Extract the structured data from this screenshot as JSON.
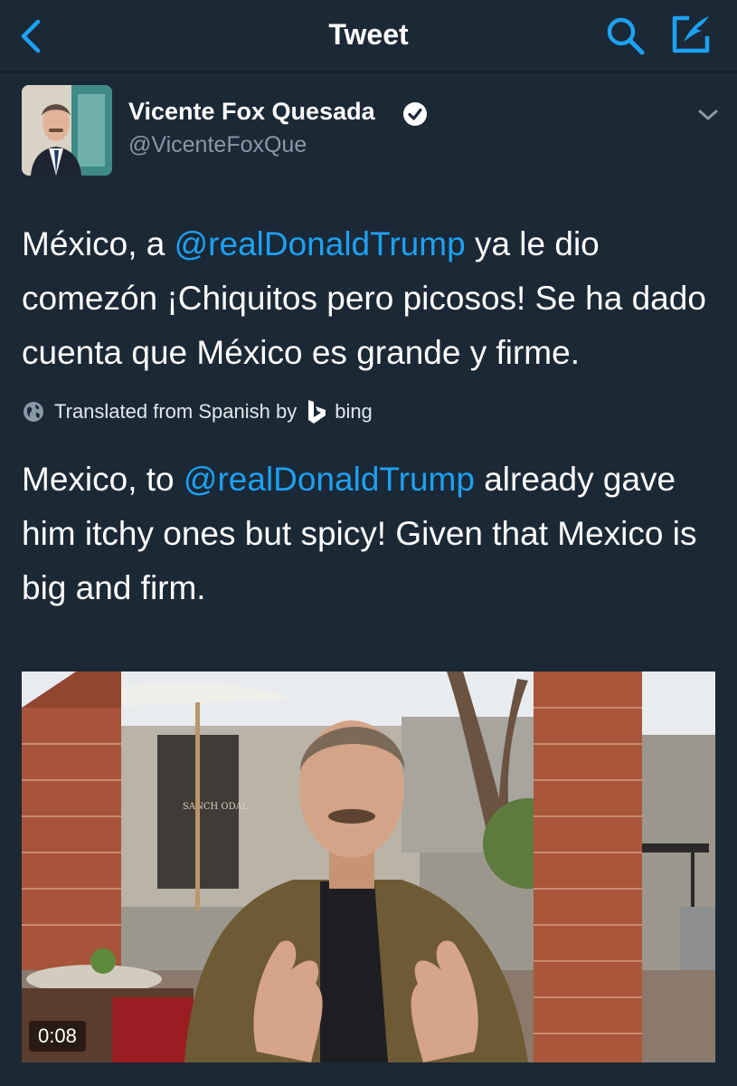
{
  "header": {
    "title": "Tweet"
  },
  "tweet": {
    "author": {
      "display_name": "Vicente Fox Quesada",
      "handle": "@VicenteFoxQue",
      "verified": true
    },
    "text": {
      "prefix": "México, a ",
      "mention": "@realDonaldTrump",
      "suffix": " ya le dio comezón ¡Chiquitos pero picosos! Se ha dado cuenta que México es grande y firme."
    },
    "translation_notice": {
      "label": "Translated from Spanish by",
      "provider": "bing"
    },
    "translated_text": {
      "prefix": "Mexico, to ",
      "mention": "@realDonaldTrump",
      "suffix": " already gave him itchy ones but spicy! Given that Mexico is big and firm."
    },
    "video": {
      "duration": "0:08",
      "sign_text": "SANCH ODAL"
    }
  },
  "colors": {
    "background": "#1b2836",
    "accent": "#1da1f2",
    "secondary_text": "#8899a6"
  }
}
